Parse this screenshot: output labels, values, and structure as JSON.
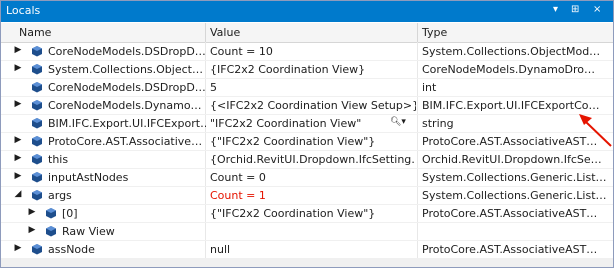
{
  "window": {
    "title": "Locals",
    "controls": [
      "▾",
      "⊞",
      "×"
    ]
  },
  "columns": {
    "name": "Name",
    "value": "Value",
    "type": "Type"
  },
  "rows": [
    {
      "expander": "▶",
      "indent": 0,
      "name": "CoreNodeModels.DSDropD…",
      "value": "Count = 10",
      "type": "System.Collections.ObjectMod…",
      "changed": false
    },
    {
      "expander": "▶",
      "indent": 0,
      "name": "System.Collections.Object…",
      "value": "{IFC2x2 Coordination View}",
      "type": "CoreNodeModels.DynamoDro…",
      "changed": false
    },
    {
      "expander": "",
      "indent": 0,
      "name": "CoreNodeModels.DSDropD…",
      "value": "5",
      "type": "int",
      "changed": false
    },
    {
      "expander": "▶",
      "indent": 0,
      "name": "CoreNodeModels.Dynamo…",
      "value": "{<IFC2x2 Coordination View Setup>}",
      "type": "BIM.IFC.Export.UI.IFCExportCo…",
      "changed": false
    },
    {
      "expander": "",
      "indent": 0,
      "name": "BIM.IFC.Export.UI.IFCExport…",
      "value": "\"IFC2x2 Coordination View\"",
      "type": "string",
      "changed": false,
      "search": true
    },
    {
      "expander": "▶",
      "indent": 0,
      "name": "ProtoCore.AST.Associative…",
      "value": "{\"IFC2x2 Coordination View\"}",
      "type": "ProtoCore.AST.AssociativeAST…",
      "changed": false
    },
    {
      "expander": "▶",
      "indent": 0,
      "name": "this",
      "value": "{Orchid.RevitUI.Dropdown.IfcSetting…",
      "type": "Orchid.RevitUI.Dropdown.IfcSe…",
      "changed": false
    },
    {
      "expander": "▶",
      "indent": 0,
      "name": "inputAstNodes",
      "value": "Count = 0",
      "type": "System.Collections.Generic.List…",
      "changed": false
    },
    {
      "expander": "◢",
      "indent": 0,
      "name": "args",
      "value": "Count = 1",
      "type": "System.Collections.Generic.List…",
      "changed": true
    },
    {
      "expander": "▶",
      "indent": 1,
      "name": "[0]",
      "value": "{\"IFC2x2 Coordination View\"}",
      "type": "ProtoCore.AST.AssociativeAST…",
      "changed": false
    },
    {
      "expander": "▶",
      "indent": 1,
      "name": "Raw View",
      "value": "",
      "type": "",
      "changed": false
    },
    {
      "expander": "▶",
      "indent": 0,
      "name": "assNode",
      "value": "null",
      "type": "ProtoCore.AST.AssociativeAST…",
      "changed": false
    }
  ],
  "colors": {
    "titlebar": "#007acc",
    "cube": "#1e4e8c",
    "changed": "#e51400",
    "arrow": "#e51400"
  },
  "icons": {
    "row_icon": "blue-cube-icon",
    "search": "magnifier-icon"
  }
}
